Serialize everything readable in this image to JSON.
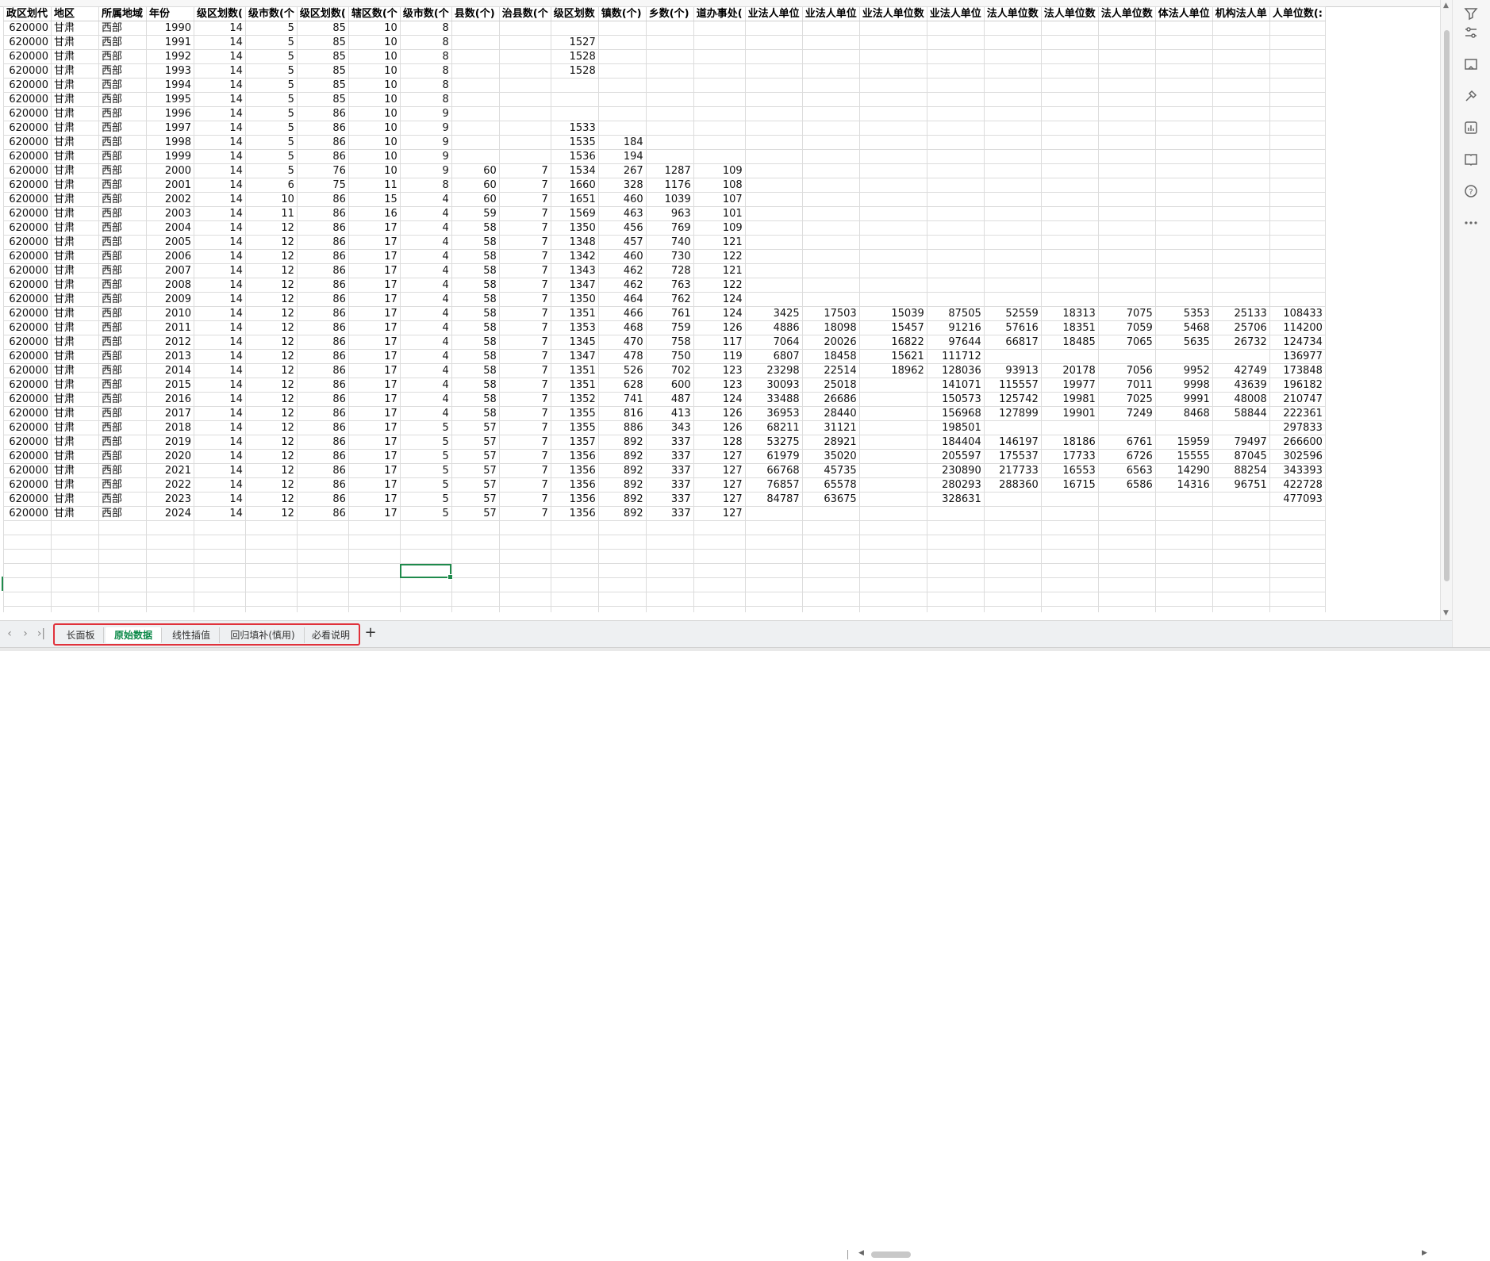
{
  "headers": [
    "政区划代",
    "地区",
    "所属地域",
    "年份",
    "级区划数(",
    "级市数(个",
    "级区划数(",
    "辖区数(个",
    "级市数(个",
    "县数(个)",
    "治县数(个",
    "级区划数",
    "镇数(个)",
    "乡数(个)",
    "道办事处(",
    "业法人单位",
    "业法人单位",
    "业法人单位数",
    "业法人单位",
    "法人单位数",
    "法人单位数",
    "法人单位数",
    "体法人单位",
    "机构法人单",
    "人单位数(:"
  ],
  "rows": [
    [
      "620000",
      "甘肃",
      "西部",
      "1990",
      "14",
      "5",
      "85",
      "10",
      "8",
      "",
      "",
      "",
      "",
      "",
      "",
      "",
      "",
      "",
      "",
      "",
      "",
      "",
      "",
      "",
      ""
    ],
    [
      "620000",
      "甘肃",
      "西部",
      "1991",
      "14",
      "5",
      "85",
      "10",
      "8",
      "",
      "",
      "1527",
      "",
      "",
      "",
      "",
      "",
      "",
      "",
      "",
      "",
      "",
      "",
      "",
      ""
    ],
    [
      "620000",
      "甘肃",
      "西部",
      "1992",
      "14",
      "5",
      "85",
      "10",
      "8",
      "",
      "",
      "1528",
      "",
      "",
      "",
      "",
      "",
      "",
      "",
      "",
      "",
      "",
      "",
      "",
      ""
    ],
    [
      "620000",
      "甘肃",
      "西部",
      "1993",
      "14",
      "5",
      "85",
      "10",
      "8",
      "",
      "",
      "1528",
      "",
      "",
      "",
      "",
      "",
      "",
      "",
      "",
      "",
      "",
      "",
      "",
      ""
    ],
    [
      "620000",
      "甘肃",
      "西部",
      "1994",
      "14",
      "5",
      "85",
      "10",
      "8",
      "",
      "",
      "",
      "",
      "",
      "",
      "",
      "",
      "",
      "",
      "",
      "",
      "",
      "",
      "",
      ""
    ],
    [
      "620000",
      "甘肃",
      "西部",
      "1995",
      "14",
      "5",
      "85",
      "10",
      "8",
      "",
      "",
      "",
      "",
      "",
      "",
      "",
      "",
      "",
      "",
      "",
      "",
      "",
      "",
      "",
      ""
    ],
    [
      "620000",
      "甘肃",
      "西部",
      "1996",
      "14",
      "5",
      "86",
      "10",
      "9",
      "",
      "",
      "",
      "",
      "",
      "",
      "",
      "",
      "",
      "",
      "",
      "",
      "",
      "",
      "",
      ""
    ],
    [
      "620000",
      "甘肃",
      "西部",
      "1997",
      "14",
      "5",
      "86",
      "10",
      "9",
      "",
      "",
      "1533",
      "",
      "",
      "",
      "",
      "",
      "",
      "",
      "",
      "",
      "",
      "",
      "",
      ""
    ],
    [
      "620000",
      "甘肃",
      "西部",
      "1998",
      "14",
      "5",
      "86",
      "10",
      "9",
      "",
      "",
      "1535",
      "184",
      "",
      "",
      "",
      "",
      "",
      "",
      "",
      "",
      "",
      "",
      "",
      ""
    ],
    [
      "620000",
      "甘肃",
      "西部",
      "1999",
      "14",
      "5",
      "86",
      "10",
      "9",
      "",
      "",
      "1536",
      "194",
      "",
      "",
      "",
      "",
      "",
      "",
      "",
      "",
      "",
      "",
      "",
      ""
    ],
    [
      "620000",
      "甘肃",
      "西部",
      "2000",
      "14",
      "5",
      "76",
      "10",
      "9",
      "60",
      "7",
      "1534",
      "267",
      "1287",
      "109",
      "",
      "",
      "",
      "",
      "",
      "",
      "",
      "",
      "",
      ""
    ],
    [
      "620000",
      "甘肃",
      "西部",
      "2001",
      "14",
      "6",
      "75",
      "11",
      "8",
      "60",
      "7",
      "1660",
      "328",
      "1176",
      "108",
      "",
      "",
      "",
      "",
      "",
      "",
      "",
      "",
      "",
      ""
    ],
    [
      "620000",
      "甘肃",
      "西部",
      "2002",
      "14",
      "10",
      "86",
      "15",
      "4",
      "60",
      "7",
      "1651",
      "460",
      "1039",
      "107",
      "",
      "",
      "",
      "",
      "",
      "",
      "",
      "",
      "",
      ""
    ],
    [
      "620000",
      "甘肃",
      "西部",
      "2003",
      "14",
      "11",
      "86",
      "16",
      "4",
      "59",
      "7",
      "1569",
      "463",
      "963",
      "101",
      "",
      "",
      "",
      "",
      "",
      "",
      "",
      "",
      "",
      ""
    ],
    [
      "620000",
      "甘肃",
      "西部",
      "2004",
      "14",
      "12",
      "86",
      "17",
      "4",
      "58",
      "7",
      "1350",
      "456",
      "769",
      "109",
      "",
      "",
      "",
      "",
      "",
      "",
      "",
      "",
      "",
      ""
    ],
    [
      "620000",
      "甘肃",
      "西部",
      "2005",
      "14",
      "12",
      "86",
      "17",
      "4",
      "58",
      "7",
      "1348",
      "457",
      "740",
      "121",
      "",
      "",
      "",
      "",
      "",
      "",
      "",
      "",
      "",
      ""
    ],
    [
      "620000",
      "甘肃",
      "西部",
      "2006",
      "14",
      "12",
      "86",
      "17",
      "4",
      "58",
      "7",
      "1342",
      "460",
      "730",
      "122",
      "",
      "",
      "",
      "",
      "",
      "",
      "",
      "",
      "",
      ""
    ],
    [
      "620000",
      "甘肃",
      "西部",
      "2007",
      "14",
      "12",
      "86",
      "17",
      "4",
      "58",
      "7",
      "1343",
      "462",
      "728",
      "121",
      "",
      "",
      "",
      "",
      "",
      "",
      "",
      "",
      "",
      ""
    ],
    [
      "620000",
      "甘肃",
      "西部",
      "2008",
      "14",
      "12",
      "86",
      "17",
      "4",
      "58",
      "7",
      "1347",
      "462",
      "763",
      "122",
      "",
      "",
      "",
      "",
      "",
      "",
      "",
      "",
      "",
      ""
    ],
    [
      "620000",
      "甘肃",
      "西部",
      "2009",
      "14",
      "12",
      "86",
      "17",
      "4",
      "58",
      "7",
      "1350",
      "464",
      "762",
      "124",
      "",
      "",
      "",
      "",
      "",
      "",
      "",
      "",
      "",
      ""
    ],
    [
      "620000",
      "甘肃",
      "西部",
      "2010",
      "14",
      "12",
      "86",
      "17",
      "4",
      "58",
      "7",
      "1351",
      "466",
      "761",
      "124",
      "3425",
      "17503",
      "15039",
      "87505",
      "52559",
      "18313",
      "7075",
      "5353",
      "25133",
      "108433"
    ],
    [
      "620000",
      "甘肃",
      "西部",
      "2011",
      "14",
      "12",
      "86",
      "17",
      "4",
      "58",
      "7",
      "1353",
      "468",
      "759",
      "126",
      "4886",
      "18098",
      "15457",
      "91216",
      "57616",
      "18351",
      "7059",
      "5468",
      "25706",
      "114200"
    ],
    [
      "620000",
      "甘肃",
      "西部",
      "2012",
      "14",
      "12",
      "86",
      "17",
      "4",
      "58",
      "7",
      "1345",
      "470",
      "758",
      "117",
      "7064",
      "20026",
      "16822",
      "97644",
      "66817",
      "18485",
      "7065",
      "5635",
      "26732",
      "124734"
    ],
    [
      "620000",
      "甘肃",
      "西部",
      "2013",
      "14",
      "12",
      "86",
      "17",
      "4",
      "58",
      "7",
      "1347",
      "478",
      "750",
      "119",
      "6807",
      "18458",
      "15621",
      "111712",
      "",
      "",
      "",
      "",
      "",
      "136977"
    ],
    [
      "620000",
      "甘肃",
      "西部",
      "2014",
      "14",
      "12",
      "86",
      "17",
      "4",
      "58",
      "7",
      "1351",
      "526",
      "702",
      "123",
      "23298",
      "22514",
      "18962",
      "128036",
      "93913",
      "20178",
      "7056",
      "9952",
      "42749",
      "173848"
    ],
    [
      "620000",
      "甘肃",
      "西部",
      "2015",
      "14",
      "12",
      "86",
      "17",
      "4",
      "58",
      "7",
      "1351",
      "628",
      "600",
      "123",
      "30093",
      "25018",
      "",
      "141071",
      "115557",
      "19977",
      "7011",
      "9998",
      "43639",
      "196182"
    ],
    [
      "620000",
      "甘肃",
      "西部",
      "2016",
      "14",
      "12",
      "86",
      "17",
      "4",
      "58",
      "7",
      "1352",
      "741",
      "487",
      "124",
      "33488",
      "26686",
      "",
      "150573",
      "125742",
      "19981",
      "7025",
      "9991",
      "48008",
      "210747"
    ],
    [
      "620000",
      "甘肃",
      "西部",
      "2017",
      "14",
      "12",
      "86",
      "17",
      "4",
      "58",
      "7",
      "1355",
      "816",
      "413",
      "126",
      "36953",
      "28440",
      "",
      "156968",
      "127899",
      "19901",
      "7249",
      "8468",
      "58844",
      "222361"
    ],
    [
      "620000",
      "甘肃",
      "西部",
      "2018",
      "14",
      "12",
      "86",
      "17",
      "5",
      "57",
      "7",
      "1355",
      "886",
      "343",
      "126",
      "68211",
      "31121",
      "",
      "198501",
      "",
      "",
      "",
      "",
      "",
      "297833"
    ],
    [
      "620000",
      "甘肃",
      "西部",
      "2019",
      "14",
      "12",
      "86",
      "17",
      "5",
      "57",
      "7",
      "1357",
      "892",
      "337",
      "128",
      "53275",
      "28921",
      "",
      "184404",
      "146197",
      "18186",
      "6761",
      "15959",
      "79497",
      "266600"
    ],
    [
      "620000",
      "甘肃",
      "西部",
      "2020",
      "14",
      "12",
      "86",
      "17",
      "5",
      "57",
      "7",
      "1356",
      "892",
      "337",
      "127",
      "61979",
      "35020",
      "",
      "205597",
      "175537",
      "17733",
      "6726",
      "15555",
      "87045",
      "302596"
    ],
    [
      "620000",
      "甘肃",
      "西部",
      "2021",
      "14",
      "12",
      "86",
      "17",
      "5",
      "57",
      "7",
      "1356",
      "892",
      "337",
      "127",
      "66768",
      "45735",
      "",
      "230890",
      "217733",
      "16553",
      "6563",
      "14290",
      "88254",
      "343393"
    ],
    [
      "620000",
      "甘肃",
      "西部",
      "2022",
      "14",
      "12",
      "86",
      "17",
      "5",
      "57",
      "7",
      "1356",
      "892",
      "337",
      "127",
      "76857",
      "65578",
      "",
      "280293",
      "288360",
      "16715",
      "6586",
      "14316",
      "96751",
      "422728"
    ],
    [
      "620000",
      "甘肃",
      "西部",
      "2023",
      "14",
      "12",
      "86",
      "17",
      "5",
      "57",
      "7",
      "1356",
      "892",
      "337",
      "127",
      "84787",
      "63675",
      "",
      "328631",
      "",
      "",
      "",
      "",
      "",
      "477093"
    ],
    [
      "620000",
      "甘肃",
      "西部",
      "2024",
      "14",
      "12",
      "86",
      "17",
      "5",
      "57",
      "7",
      "1356",
      "892",
      "337",
      "127",
      "",
      "",
      "",
      "",
      "",
      "",
      "",
      "",
      "",
      ""
    ]
  ],
  "sheet_tabs": [
    "长面板",
    "原始数据",
    "线性插值",
    "回归填补(慎用)",
    "必看说明"
  ],
  "active_tab_index": 1,
  "add_tab_label": "+",
  "nav": {
    "first": "‹",
    "prev": "›",
    "last": "›|"
  },
  "side_icons": [
    "filter-icon",
    "adjust-icon",
    "frame-icon",
    "tools-icon",
    "chart-icon",
    "book-icon",
    "help-icon",
    "more-icon"
  ],
  "colors": {
    "accent": "#1f8a4c",
    "tab_active": "#0e8a4a",
    "highlight_box": "#e0323b"
  }
}
